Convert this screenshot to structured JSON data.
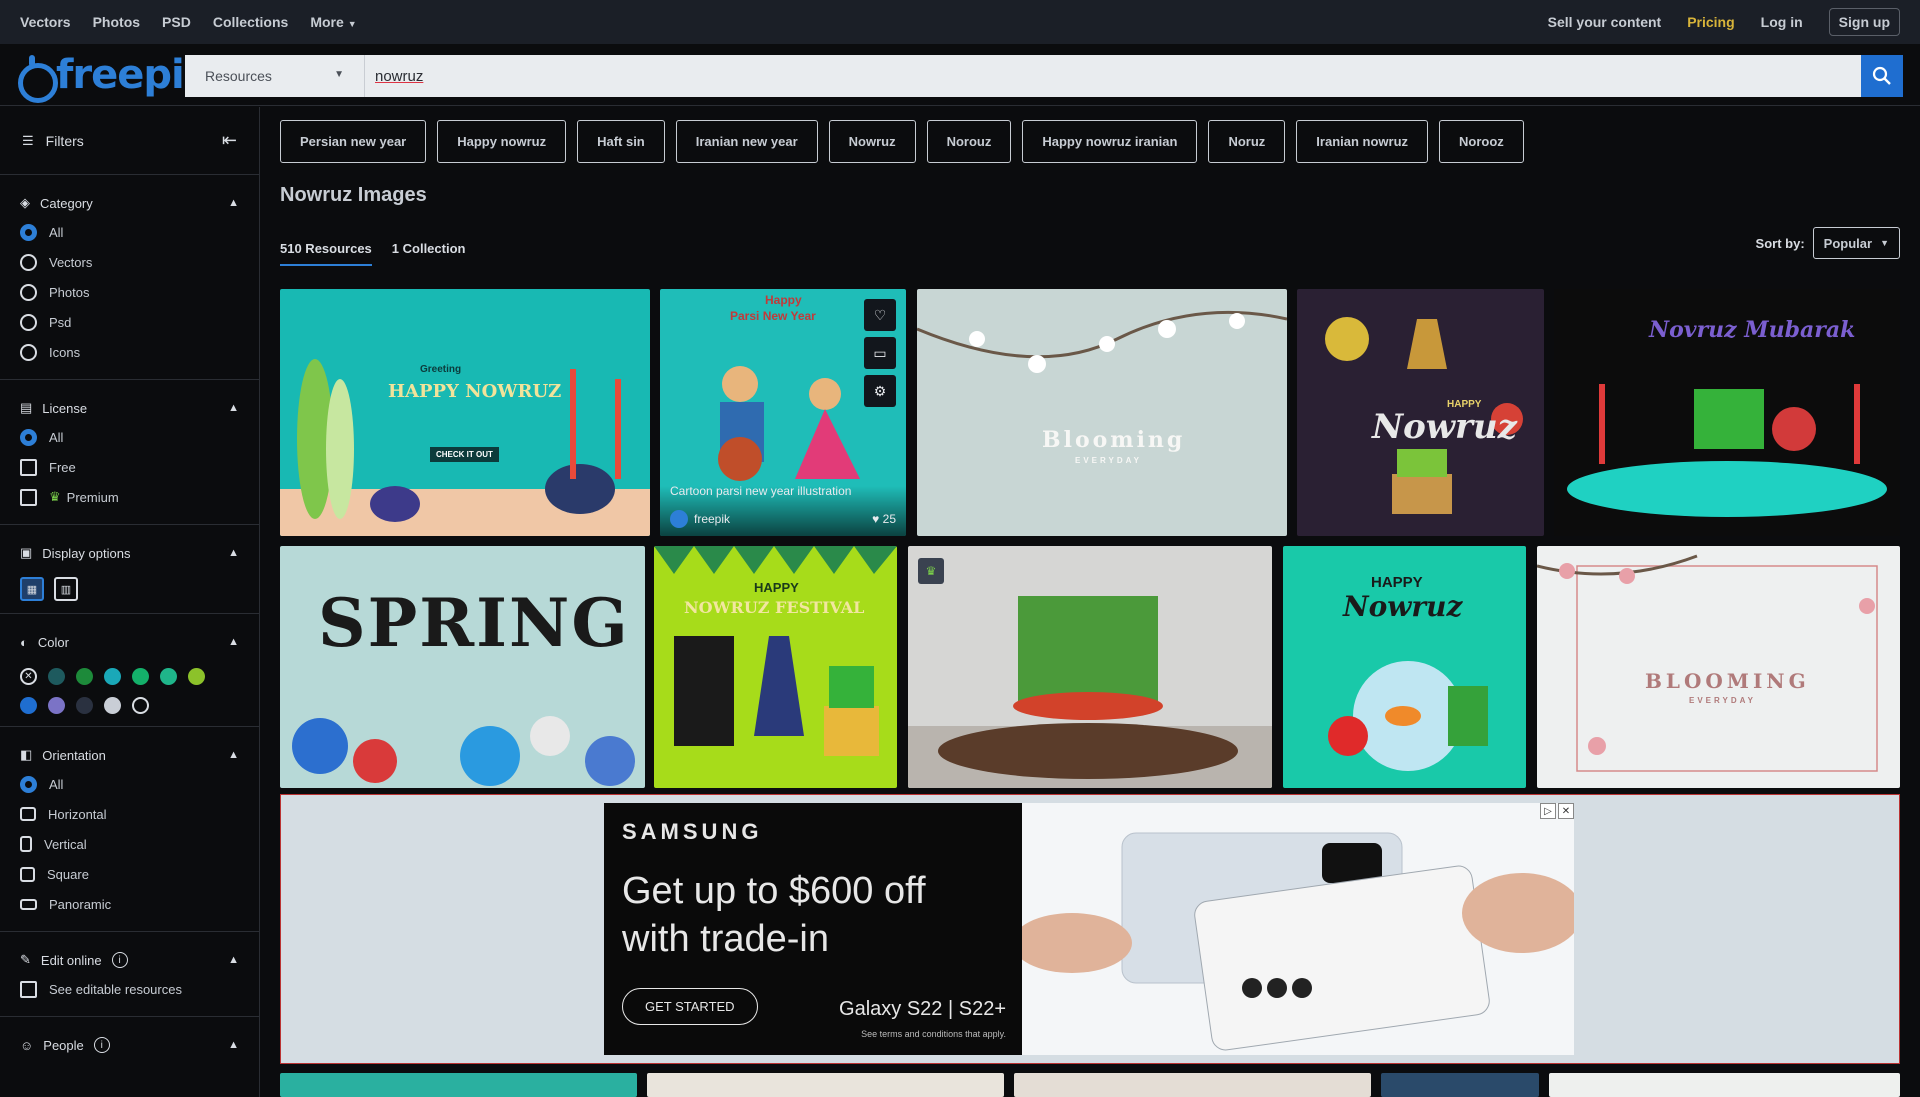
{
  "topnav": {
    "left": [
      "Vectors",
      "Photos",
      "PSD",
      "Collections",
      "More"
    ],
    "sell": "Sell your content",
    "pricing": "Pricing",
    "login": "Log in",
    "signup": "Sign up"
  },
  "brand": "freepik",
  "search": {
    "category": "Resources",
    "query": "nowruz"
  },
  "sidebar": {
    "title": "Filters",
    "category": {
      "title": "Category",
      "options": [
        "All",
        "Vectors",
        "Photos",
        "Psd",
        "Icons"
      ]
    },
    "license": {
      "title": "License",
      "options": [
        "All",
        "Free",
        "Premium"
      ]
    },
    "display": {
      "title": "Display options"
    },
    "color": {
      "title": "Color",
      "swatches": [
        "#1e5a5e",
        "#1d8a3a",
        "#1aa8b8",
        "#14b06a",
        "#1fb58a",
        "#8cc22a",
        "#1f6ed0",
        "#7b73c6",
        "#2a3140",
        "#c9ced6",
        "#0b0c0e"
      ]
    },
    "orientation": {
      "title": "Orientation",
      "options": [
        "All",
        "Horizontal",
        "Vertical",
        "Square",
        "Panoramic"
      ]
    },
    "edit_online": {
      "title": "Edit online",
      "option": "See editable resources"
    },
    "people": {
      "title": "People"
    }
  },
  "chips": [
    "Persian new year",
    "Happy nowruz",
    "Haft sin",
    "Iranian new year",
    "Nowruz",
    "Norouz",
    "Happy nowruz iranian",
    "Noruz",
    "Iranian nowruz",
    "Norooz"
  ],
  "page_title": "Nowruz Images",
  "tabs": {
    "resources": "510 Resources",
    "collections": "1 Collection"
  },
  "sort": {
    "label": "Sort by:",
    "value": "Popular"
  },
  "thumbs": {
    "t1": {
      "small": "Greeting",
      "main": "HAPPY NOWRUZ",
      "btn": "CHECK IT OUT"
    },
    "t2": {
      "top1": "Happy",
      "top2": "Parsi New Year",
      "title": "Cartoon parsi new year illustration",
      "author": "freepik",
      "likes": "25"
    },
    "t3": {
      "main": "Blooming",
      "sub": "EVERYDAY"
    },
    "t4": {
      "happy": "HAPPY",
      "main": "Nowruz"
    },
    "t5": {
      "main": "Novruz Mubarak"
    },
    "t6": {
      "main": "SPRING"
    },
    "t7": {
      "happy": "HAPPY",
      "main": "NOWRUZ FESTIVAL"
    },
    "t9": {
      "happy": "HAPPY",
      "main": "Nowruz"
    },
    "t10": {
      "main": "BLOOMING",
      "sub": "EVERYDAY"
    }
  },
  "ad": {
    "brand": "SAMSUNG",
    "headline_1": "Get up to $600 off",
    "headline_2": "with trade-in",
    "cta": "GET STARTED",
    "model": "Galaxy S22 | S22+",
    "terms": "See terms and conditions that apply."
  }
}
